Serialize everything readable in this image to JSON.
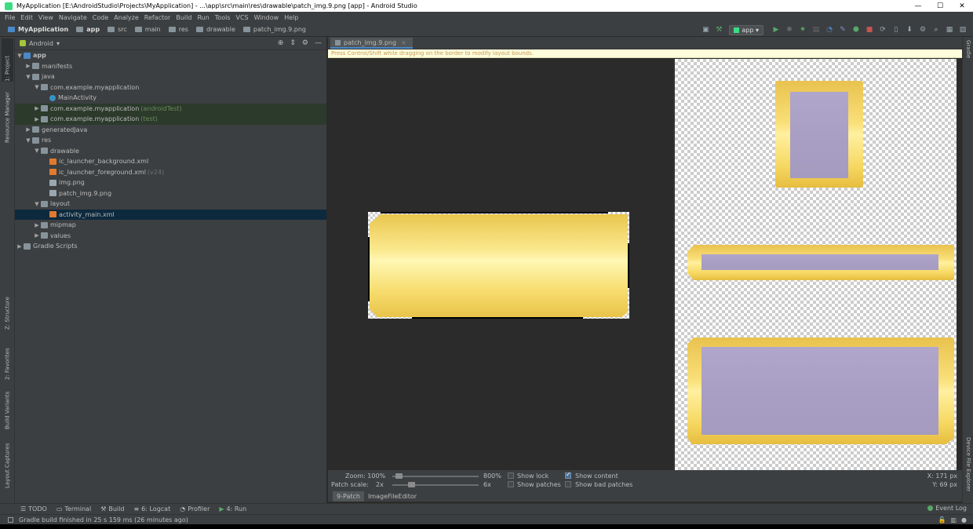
{
  "window": {
    "title": "MyApplication [E:\\AndroidStudio\\Projects\\MyApplication] - ...\\app\\src\\main\\res\\drawable\\patch_img.9.png [app] - Android Studio",
    "minimize": "—",
    "maximize": "☐",
    "close": "✕"
  },
  "menu": [
    "File",
    "Edit",
    "View",
    "Navigate",
    "Code",
    "Analyze",
    "Refactor",
    "Build",
    "Run",
    "Tools",
    "VCS",
    "Window",
    "Help"
  ],
  "breadcrumb": [
    "MyApplication",
    "app",
    "src",
    "main",
    "res",
    "drawable",
    "patch_img.9.png"
  ],
  "toolbar": {
    "run_config": "app"
  },
  "left_tabs": [
    "1: Project",
    "Resource Manager",
    "Z: Structure",
    "2: Favorites",
    "Build Variants",
    "Layout Captures"
  ],
  "right_tabs": [
    "Gradle",
    "Device File Explorer"
  ],
  "project": {
    "view": "Android",
    "tree": [
      {
        "label": "app",
        "depth": 0,
        "arrow": "▼",
        "icon": "module"
      },
      {
        "label": "manifests",
        "depth": 1,
        "arrow": "▶",
        "icon": "folder"
      },
      {
        "label": "java",
        "depth": 1,
        "arrow": "▼",
        "icon": "folder"
      },
      {
        "label": "com.example.myapplication",
        "depth": 2,
        "arrow": "▼",
        "icon": "package"
      },
      {
        "label": "MainActivity",
        "depth": 3,
        "arrow": "",
        "icon": "class"
      },
      {
        "label": "com.example.myapplication",
        "hint": "(androidTest)",
        "depth": 2,
        "arrow": "▶",
        "icon": "package",
        "style": "g"
      },
      {
        "label": "com.example.myapplication",
        "hint": "(test)",
        "depth": 2,
        "arrow": "▶",
        "icon": "package",
        "style": "g"
      },
      {
        "label": "generatedJava",
        "depth": 1,
        "arrow": "▶",
        "icon": "folder"
      },
      {
        "label": "res",
        "depth": 1,
        "arrow": "▼",
        "icon": "folder"
      },
      {
        "label": "drawable",
        "depth": 2,
        "arrow": "▼",
        "icon": "folder"
      },
      {
        "label": "ic_launcher_background.xml",
        "depth": 3,
        "arrow": "",
        "icon": "xml"
      },
      {
        "label": "ic_launcher_foreground.xml",
        "hint2": "(v24)",
        "depth": 3,
        "arrow": "",
        "icon": "xml"
      },
      {
        "label": "img.png",
        "depth": 3,
        "arrow": "",
        "icon": "image"
      },
      {
        "label": "patch_img.9.png",
        "depth": 3,
        "arrow": "",
        "icon": "image"
      },
      {
        "label": "layout",
        "depth": 2,
        "arrow": "▼",
        "icon": "folder"
      },
      {
        "label": "activity_main.xml",
        "depth": 3,
        "arrow": "",
        "icon": "xml",
        "style": "sel"
      },
      {
        "label": "mipmap",
        "depth": 2,
        "arrow": "▶",
        "icon": "folder"
      },
      {
        "label": "values",
        "depth": 2,
        "arrow": "▶",
        "icon": "folder"
      },
      {
        "label": "Gradle Scripts",
        "depth": 0,
        "arrow": "▶",
        "icon": "gradle"
      }
    ]
  },
  "editor": {
    "tab": "patch_img.9.png",
    "hint": "Press Control/Shift while dragging on the border to modify layout bounds.",
    "zoom_label": "Zoom: 100%",
    "zoom_max": "800%",
    "patch_label": "Patch scale:",
    "patch_min": "2x",
    "patch_max": "6x",
    "show_lock": "Show lock",
    "show_patches": "Show patches",
    "show_content": "Show content",
    "show_bad": "Show bad patches",
    "show_content_checked": true,
    "coord_x": "X: 171 px",
    "coord_y": "Y:   69 px",
    "bottom_tabs": [
      "9-Patch",
      "ImageFileEditor"
    ]
  },
  "toolwindows": [
    "TODO",
    "Terminal",
    "Build",
    "6: Logcat",
    "Profiler",
    "4: Run"
  ],
  "event_log": "Event Log",
  "status": "Gradle build finished in 25 s 159 ms (26 minutes ago)",
  "colors": {
    "accent": "#4a88c7",
    "selection": "#0d293e",
    "plate": "#f9e07a",
    "content": "#a99ec4"
  }
}
